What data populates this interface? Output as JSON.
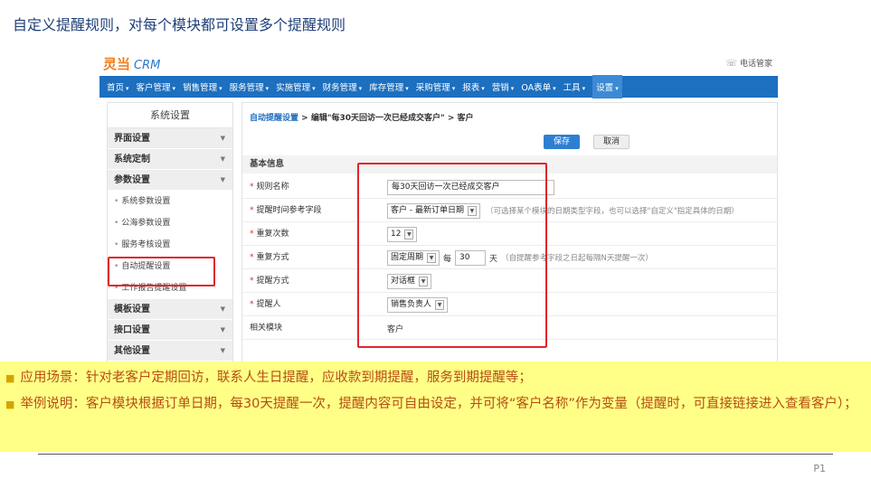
{
  "slide": {
    "title": "自定义提醒规则，对每个模块都可设置多个提醒规则",
    "page_number": "P1"
  },
  "app": {
    "logo_cn": "灵当",
    "logo_en": "CRM",
    "phone_label": "电话管家",
    "phone_icon": "phone-icon"
  },
  "nav": [
    {
      "label": "首页",
      "caret": "▾"
    },
    {
      "label": "客户管理",
      "caret": "▾"
    },
    {
      "label": "销售管理",
      "caret": "▾"
    },
    {
      "label": "服务管理",
      "caret": "▾"
    },
    {
      "label": "实施管理",
      "caret": "▾"
    },
    {
      "label": "财务管理",
      "caret": "▾"
    },
    {
      "label": "库存管理",
      "caret": "▾"
    },
    {
      "label": "采购管理",
      "caret": "▾"
    },
    {
      "label": "报表",
      "caret": "▾"
    },
    {
      "label": "营销",
      "caret": "▾"
    },
    {
      "label": "OA表单",
      "caret": "▾"
    },
    {
      "label": "工具",
      "caret": "▾"
    },
    {
      "label": "设置",
      "caret": "▾"
    }
  ],
  "sidebar": {
    "title": "系统设置",
    "groups_top": [
      "界面设置",
      "系统定制",
      "参数设置"
    ],
    "items": [
      "系统参数设置",
      "公海参数设置",
      "服务考核设置",
      "自动提醒设置",
      "工作报告提醒设置"
    ],
    "groups_bottom": [
      "模板设置",
      "接口设置",
      "其他设置"
    ]
  },
  "content": {
    "breadcrumb_link": "自动提醒设置",
    "breadcrumb_rest": " > 编辑\"每30天回访一次已经成交客户\" > 客户",
    "save_label": "保存",
    "cancel_label": "取消",
    "section_title": "基本信息",
    "fields": {
      "rule_name": {
        "label": "规则名称",
        "value": "每30天回访一次已经成交客户"
      },
      "ref_field": {
        "label": "提醒时间参考字段",
        "value": "客户 - 最新订单日期",
        "hint": "（可选择某个模块的日期类型字段，也可以选择\"自定义\"指定具体的日期）"
      },
      "repeat_count": {
        "label": "重复次数",
        "value": "12"
      },
      "repeat_mode": {
        "label": "重复方式",
        "value": "固定周期",
        "every": "每",
        "days": "30",
        "unit": "天",
        "hint": "（自提醒参考字段之日起每隔N天提醒一次）"
      },
      "remind_mode": {
        "label": "提醒方式",
        "value": "对话框"
      },
      "reminder": {
        "label": "提醒人",
        "value": "销售负责人"
      },
      "module": {
        "label": "相关模块",
        "value": "客户"
      }
    },
    "required_mark": "*",
    "dropdown_icon": "chevron-down-icon"
  },
  "notes": {
    "scenario": "应用场景：针对老客户定期回访，联系人生日提醒，应收款到期提醒，服务到期提醒等；",
    "example": "举例说明：客户模块根据订单日期，每30天提醒一次，提醒内容可自由设定，并可将“客户名称”作为变量（提醒时，可直接链接进入查看客户）；",
    "bullet": "■"
  },
  "colors": {
    "nav_bg": "#1d6fbf",
    "highlight_box": "#e0252b",
    "notes_bg": "#ffff88",
    "notes_text": "#b74d0f"
  }
}
